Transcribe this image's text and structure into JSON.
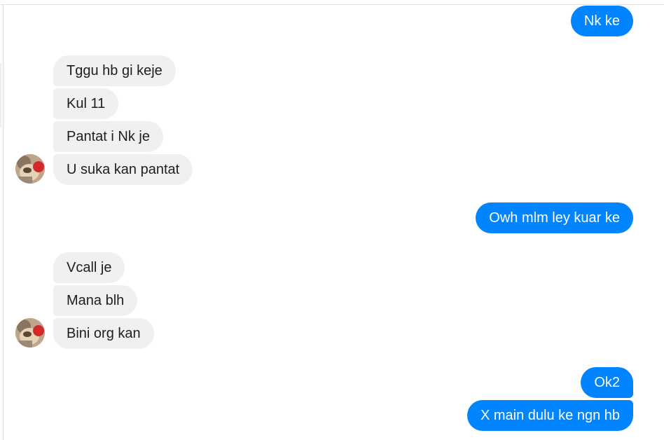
{
  "conversation": {
    "messages": [
      {
        "side": "out",
        "text": "Nk ke"
      },
      {
        "side": "in",
        "text": "Tggu hb gi keje"
      },
      {
        "side": "in",
        "text": "Kul 11"
      },
      {
        "side": "in",
        "text": "Pantat i Nk je"
      },
      {
        "side": "in",
        "text": "U suka kan pantat"
      },
      {
        "side": "out",
        "text": "Owh mlm ley kuar ke"
      },
      {
        "side": "in",
        "text": "Vcall je"
      },
      {
        "side": "in",
        "text": "Mana blh"
      },
      {
        "side": "in",
        "text": "Bini org kan"
      },
      {
        "side": "out",
        "text": "Ok2"
      },
      {
        "side": "out",
        "text": "X main dulu ke ngn hb"
      }
    ]
  },
  "colors": {
    "outgoing_bubble": "#0084ff",
    "incoming_bubble": "#f1f0f0",
    "background": "#ffffff"
  }
}
